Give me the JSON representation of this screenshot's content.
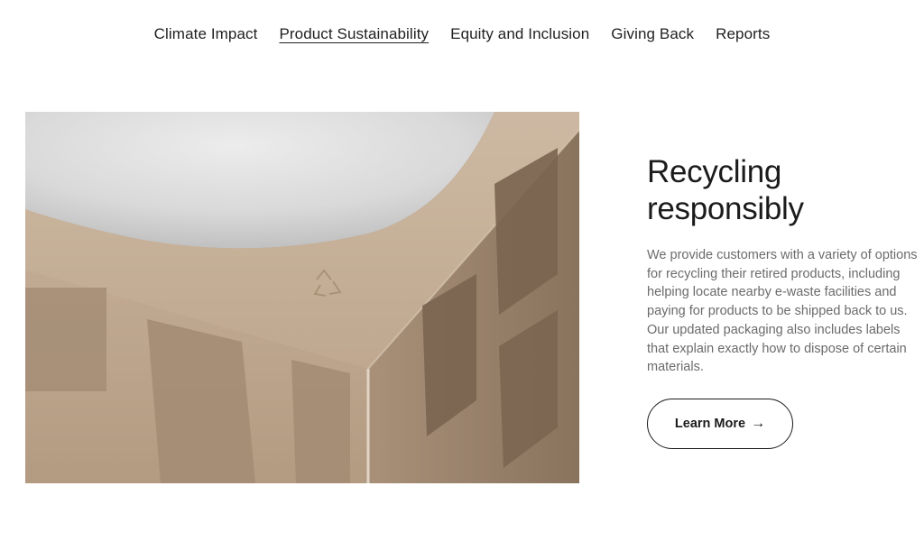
{
  "nav": {
    "items": [
      {
        "label": "Climate Impact",
        "active": false
      },
      {
        "label": "Product Sustainability",
        "active": true
      },
      {
        "label": "Equity and Inclusion",
        "active": false
      },
      {
        "label": "Giving Back",
        "active": false
      },
      {
        "label": "Reports",
        "active": false
      }
    ]
  },
  "hero": {
    "image_alt": "Molded pulp packaging corner with embossed recycling symbol"
  },
  "section": {
    "heading": "Recycling responsibly",
    "body": "We provide customers with a variety of options for recycling their retired products, including helping locate nearby e-waste facilities and paying for products to be shipped back to us. Our updated packaging also includes labels that explain exactly how to dispose of certain materials.",
    "cta_label": "Learn More",
    "cta_icon": "arrow-right-icon"
  },
  "colors": {
    "text": "#1b1b1b",
    "body_text": "#6b6b6b",
    "pulp": "#c9b59f"
  }
}
